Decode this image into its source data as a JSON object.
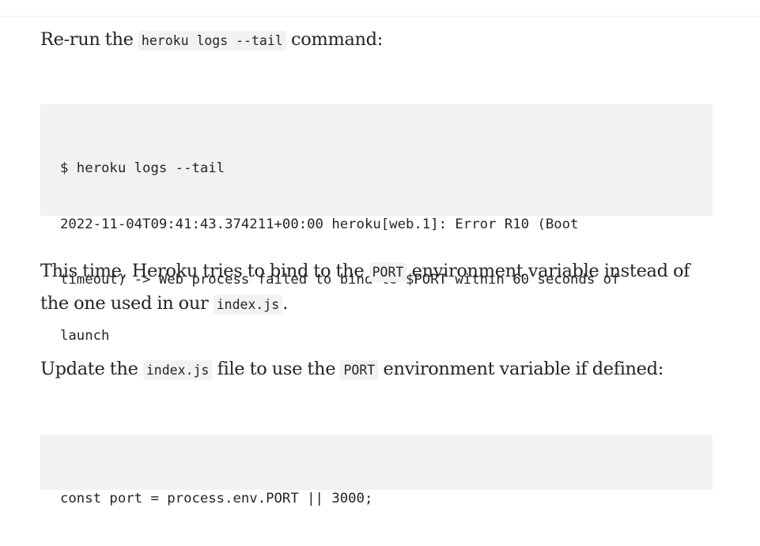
{
  "para1": {
    "before": "Re-run the ",
    "code": "heroku logs --tail",
    "after": " command:"
  },
  "code_block_1": {
    "lines": [
      "$ heroku logs --tail",
      "2022-11-04T09:41:43.374211+00:00 heroku[web.1]: Error R10 (Boot",
      "timeout) -> Web process failed to bind to $PORT within 60 seconds of",
      "launch"
    ]
  },
  "para2": {
    "line1_before": "This time, Heroku tries to bind to the ",
    "line1_code": "PORT",
    "line1_after": " environment variable instead of",
    "line2_before": "the one used in our ",
    "line2_code": "index.js",
    "line2_after": "."
  },
  "para3": {
    "before": "Update the ",
    "code1": "index.js",
    "middle": " file to use the ",
    "code2": "PORT",
    "after": " environment variable if defined:"
  },
  "code_block_2": {
    "lines": [
      "const port = process.env.PORT || 3000;"
    ]
  }
}
